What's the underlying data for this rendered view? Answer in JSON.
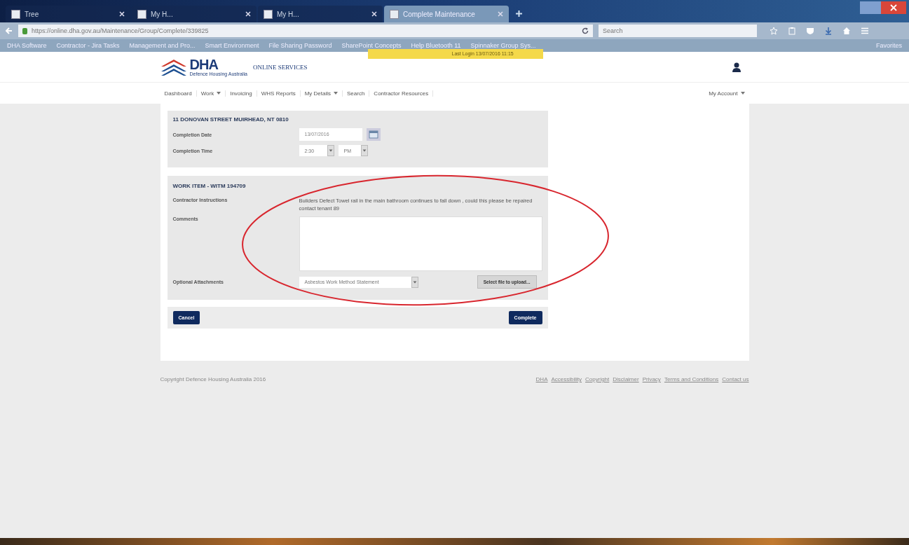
{
  "browser": {
    "tabs": [
      {
        "title": "Tree",
        "selected": false
      },
      {
        "title": "My H...",
        "selected": false
      },
      {
        "title": "My H...",
        "selected": false
      },
      {
        "title": "Complete Maintenance",
        "selected": true
      }
    ],
    "url": "https://online.dha.gov.au/Maintenance/Group/Complete/339825",
    "search": {
      "placeholder": "Search"
    },
    "bookmarks": [
      "DHA Software",
      "Contractor - Jira Tasks",
      "Management and Pro...",
      "Smart Environment",
      "File Sharing Password",
      "SharePoint Concepts",
      "Help Bluetooth 11",
      "Spinnaker Group Sys..."
    ],
    "bookmarks_end": "Favorites"
  },
  "header": {
    "logo": "DHA",
    "logo_sub": "Defence Housing Australia",
    "service": "ONLINE SERVICES",
    "last_login": "Last Login 13/07/2016 11:15"
  },
  "nav": {
    "items": [
      {
        "label": "Dashboard",
        "dropdown": false
      },
      {
        "label": "Work",
        "dropdown": true
      },
      {
        "label": "Invoicing",
        "dropdown": false
      },
      {
        "label": "WHS Reports",
        "dropdown": false
      },
      {
        "label": "My Details",
        "dropdown": true
      },
      {
        "label": "Search",
        "dropdown": false
      },
      {
        "label": "Contractor Resources",
        "dropdown": false
      }
    ],
    "account": "My Account"
  },
  "property": {
    "title": "11 DONOVAN STREET MUIRHEAD, NT 0810",
    "date_label": "Completion Date",
    "date": "13/07/2016",
    "time_label": "Completion Time",
    "hour": "2:30",
    "ampm": "PM"
  },
  "work_item": {
    "title": "WORK ITEM - WITM 194709",
    "instructions_label": "Contractor Instructions",
    "instructions": "Builders Defect Towel rail in the main bathroom continues to fall down , could this please be repaired contact tenant 89",
    "comments_label": "Comments",
    "attachments_label": "Optional Attachments",
    "attachment_type": "Asbestos Work Method Statement",
    "upload": "Select file to upload..."
  },
  "actions": {
    "cancel": "Cancel",
    "complete": "Complete"
  },
  "footer": {
    "copyright": "Copyright Defence Housing Australia 2016",
    "links": [
      "DHA",
      "Accessibility",
      "Copyright",
      "Disclaimer",
      "Privacy",
      "Terms and Conditions",
      "Contact us"
    ]
  }
}
